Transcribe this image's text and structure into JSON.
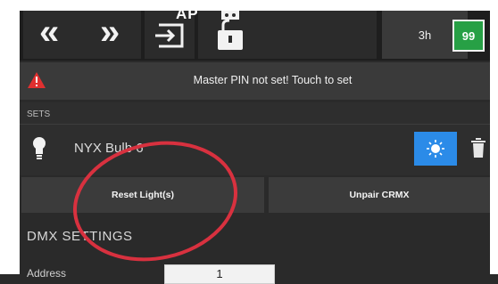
{
  "topbar": {
    "prev_icon": "double-chevron-left-icon",
    "prev_label": "«",
    "next_icon": "double-chevron-right-icon",
    "next_label": "»",
    "app_label": "APP",
    "app_icon": "exit-arrow-icon",
    "lock_icon": "robot-lock-icon",
    "time_chip": "3h",
    "battery_value": "99",
    "battery_color": "#27a045"
  },
  "alert": {
    "icon": "warning-triangle-icon",
    "text": "Master PIN not set! Touch to set"
  },
  "sets": {
    "label": "SETS",
    "light": {
      "icon": "bulb-icon",
      "name": "NYX Bulb 6",
      "locate_icon": "sun-icon",
      "delete_icon": "trash-icon"
    }
  },
  "actions": {
    "reset": "Reset Light(s)",
    "unpair": "Unpair CRMX"
  },
  "dmx": {
    "title": "DMX SETTINGS",
    "row_label": "Address",
    "row_value": "1"
  },
  "colors": {
    "accent_blue": "#2b8be8",
    "annotation_red": "#d8313f"
  }
}
